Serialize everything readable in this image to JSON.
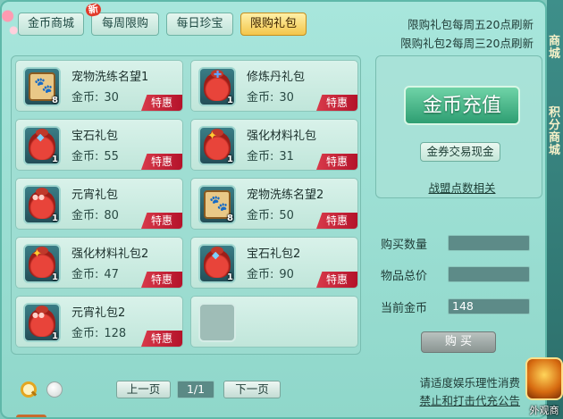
{
  "tabs": [
    {
      "label": "金币商城",
      "active": false
    },
    {
      "label": "每周限购",
      "active": false,
      "badge": "新"
    },
    {
      "label": "每日珍宝",
      "active": false
    },
    {
      "label": "限购礼包",
      "active": true
    }
  ],
  "refresh_notes": [
    "限购礼包每周五20点刷新",
    "限购礼包2每周三20点刷新"
  ],
  "items": [
    {
      "name": "宠物洗练名望1",
      "price_label": "金币:",
      "price": "30",
      "count": "8",
      "tag": "特惠",
      "icon": "paw-scroll-icon"
    },
    {
      "name": "修炼丹礼包",
      "price_label": "金币:",
      "price": "30",
      "count": "1",
      "tag": "特惠",
      "icon": "pill-bag-icon"
    },
    {
      "name": "宝石礼包",
      "price_label": "金币:",
      "price": "55",
      "count": "1",
      "tag": "特惠",
      "icon": "gem-bag-icon"
    },
    {
      "name": "强化材料礼包",
      "price_label": "金币:",
      "price": "31",
      "count": "1",
      "tag": "特惠",
      "icon": "material-bag-icon"
    },
    {
      "name": "元宵礼包",
      "price_label": "金币:",
      "price": "80",
      "count": "1",
      "tag": "特惠",
      "icon": "lantern-bag-icon"
    },
    {
      "name": "宠物洗练名望2",
      "price_label": "金币:",
      "price": "50",
      "count": "8",
      "tag": "特惠",
      "icon": "paw-scroll-icon"
    },
    {
      "name": "强化材料礼包2",
      "price_label": "金币:",
      "price": "47",
      "count": "1",
      "tag": "特惠",
      "icon": "material-bag-icon"
    },
    {
      "name": "宝石礼包2",
      "price_label": "金币:",
      "price": "90",
      "count": "1",
      "tag": "特惠",
      "icon": "gem-bag-icon"
    },
    {
      "name": "元宵礼包2",
      "price_label": "金币:",
      "price": "128",
      "count": "1",
      "tag": "特惠",
      "icon": "lantern-bag-icon"
    }
  ],
  "recharge_label": "金币充值",
  "exchange_label": "金券交易现金",
  "alliance_label": "战盟点数相关",
  "fields": [
    {
      "label": "购买数量",
      "value": ""
    },
    {
      "label": "物品总价",
      "value": ""
    },
    {
      "label": "当前金币",
      "value": "148"
    }
  ],
  "buy_label": "购 买",
  "footer": [
    "请适度娱乐理性消费",
    "禁止和打击代充公告"
  ],
  "pagination": {
    "prev": "上一页",
    "indicator": "1/1",
    "next": "下一页"
  },
  "side": {
    "text_top": "商城",
    "text_mid": "积分商城",
    "badge_label": "外观商"
  }
}
